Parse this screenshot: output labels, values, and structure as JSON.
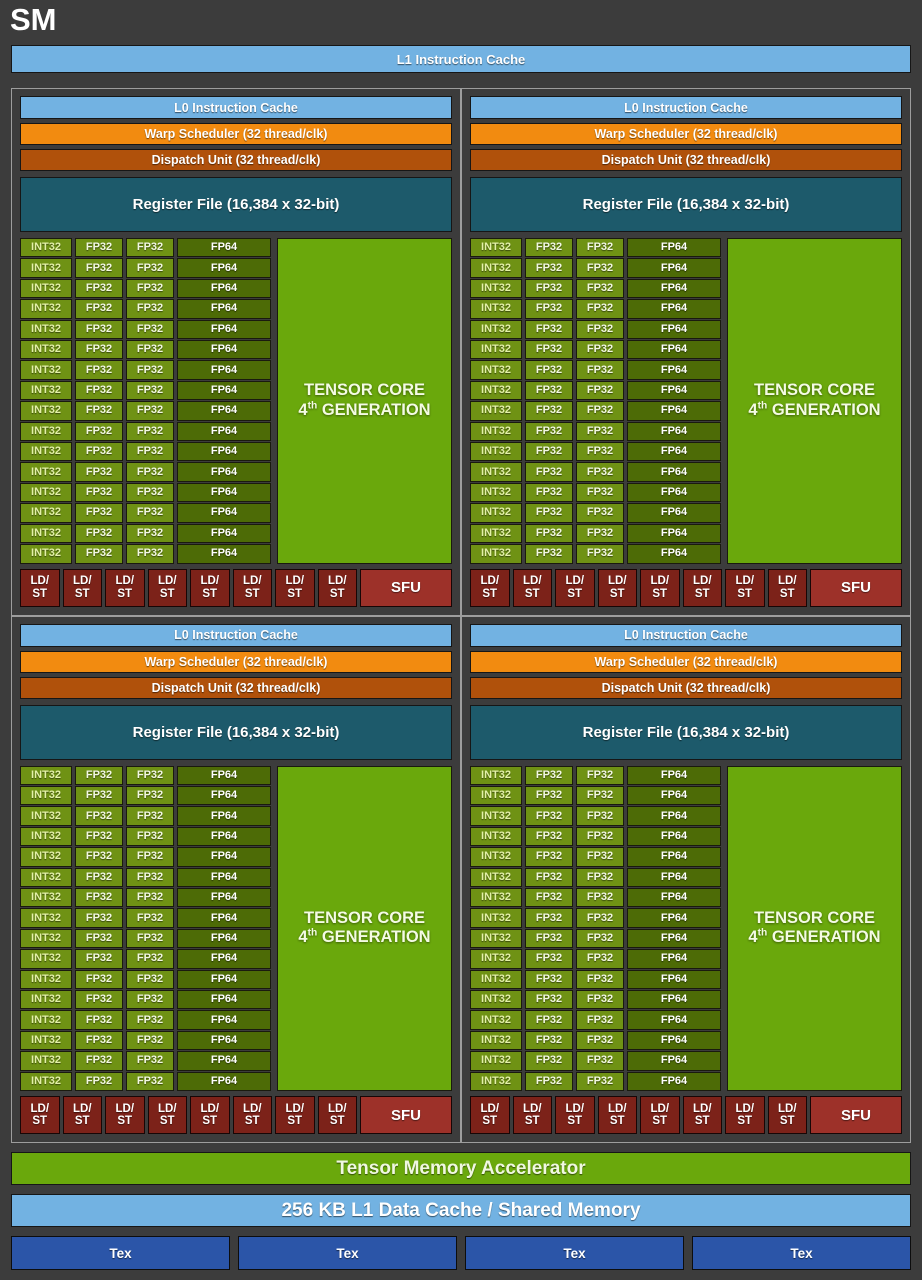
{
  "diagram": {
    "title": "SM",
    "l1_instruction_cache": "L1 Instruction Cache",
    "tensor_memory_accelerator": "Tensor Memory Accelerator",
    "l1_data_cache": "256 KB L1 Data Cache / Shared Memory"
  },
  "processing_block": {
    "l0_instruction_cache": "L0 Instruction Cache",
    "warp_scheduler": "Warp Scheduler (32 thread/clk)",
    "dispatch_unit": "Dispatch Unit (32 thread/clk)",
    "register_file": "Register File (16,384 x 32-bit)",
    "tensor_core_line1": "TENSOR CORE",
    "tensor_core_line2_prefix": "4",
    "tensor_core_line2_sup": "th",
    "tensor_core_line2_suffix": " GENERATION",
    "core_labels": {
      "int32": "INT32",
      "fp32": "FP32",
      "fp64": "FP64"
    },
    "core_rows": 16,
    "fp32_columns": 2,
    "ldst_label": "LD/\nST",
    "ldst_line1": "LD/",
    "ldst_line2": "ST",
    "ldst_count": 8,
    "sfu_label": "SFU"
  },
  "tex_units": [
    {
      "label": "Tex"
    },
    {
      "label": "Tex"
    },
    {
      "label": "Tex"
    },
    {
      "label": "Tex"
    }
  ],
  "quadrant_count": 4,
  "colors": {
    "background": "#3c3c3c",
    "cache_blue": "#72b2e2",
    "warp_orange": "#f28b10",
    "dispatch_brown": "#b0510b",
    "register_teal": "#1d5a6b",
    "core_green": "#6f9214",
    "fp64_green": "#4d6b06",
    "tensor_green": "#6aa80c",
    "ldst_red": "#7c2219",
    "sfu_red": "#9d3129",
    "tex_blue": "#2b55a8",
    "frame_gray": "#9d9d9d"
  }
}
